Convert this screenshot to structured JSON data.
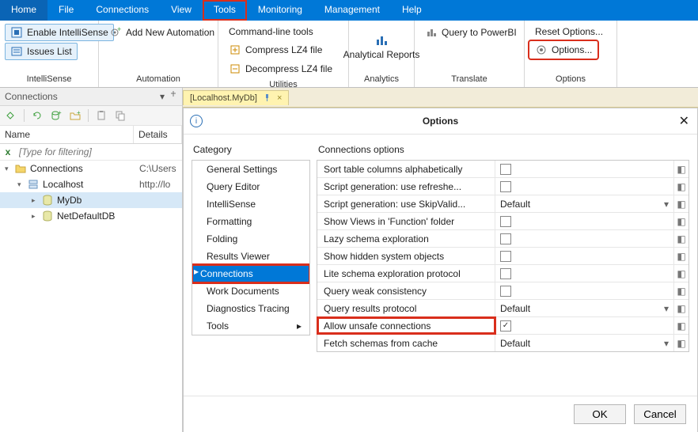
{
  "menu": [
    "Home",
    "File",
    "Connections",
    "View",
    "Tools",
    "Monitoring",
    "Management",
    "Help"
  ],
  "menu_hl_index": 4,
  "ribbon": {
    "intellisense": {
      "enable": "Enable IntelliSense",
      "issues": "Issues List",
      "label": "IntelliSense"
    },
    "automation": {
      "add": "Add New Automation",
      "label": "Automation"
    },
    "utilities": {
      "cmd": "Command-line tools",
      "compress": "Compress LZ4 file",
      "decompress": "Decompress LZ4 file",
      "label": "Utilities"
    },
    "analytics": {
      "reports": "Analytical\nReports",
      "label": "Analytics"
    },
    "translate": {
      "query": "Query to PowerBI",
      "label": "Translate"
    },
    "options": {
      "reset": "Reset Options...",
      "options": "Options...",
      "label": "Options"
    }
  },
  "left": {
    "title": "Connections",
    "col_name": "Name",
    "col_details": "Details",
    "filter_placeholder": "[Type for filtering]",
    "tree": [
      {
        "level": 0,
        "exp": "▾",
        "icon": "folder",
        "label": "Connections",
        "details": "C:\\Users"
      },
      {
        "level": 1,
        "exp": "▾",
        "icon": "server",
        "label": "Localhost",
        "details": "http://lo"
      },
      {
        "level": 2,
        "exp": "▸",
        "icon": "db",
        "label": "MyDb",
        "details": "",
        "sel": true
      },
      {
        "level": 2,
        "exp": "▸",
        "icon": "db",
        "label": "NetDefaultDB",
        "details": ""
      }
    ]
  },
  "doc_tab": "[Localhost.MyDb]",
  "dialog": {
    "title": "Options",
    "cat_title": "Category",
    "categories": [
      {
        "label": "General Settings",
        "sub": true
      },
      {
        "label": "Query Editor",
        "sub": true
      },
      {
        "label": "IntelliSense",
        "sub": true
      },
      {
        "label": "Formatting",
        "sub": true
      },
      {
        "label": "Folding",
        "sub": true
      },
      {
        "label": "Results Viewer",
        "sub": true
      },
      {
        "label": "Connections",
        "sub": false,
        "sel": true,
        "hl": true
      },
      {
        "label": "Work Documents",
        "sub": true
      },
      {
        "label": "Diagnostics Tracing",
        "sub": true
      },
      {
        "label": "Tools",
        "sub": true,
        "expand": true
      }
    ],
    "opt_title": "Connections options",
    "options": [
      {
        "name": "Sort table columns alphabetically",
        "value": "",
        "check": false
      },
      {
        "name": "Script generation: use refreshe...",
        "value": "",
        "check": false
      },
      {
        "name": "Script generation: use SkipValid...",
        "value": "Default",
        "check": null
      },
      {
        "name": "Show Views in 'Function' folder",
        "value": "",
        "check": false
      },
      {
        "name": "Lazy schema exploration",
        "value": "",
        "check": false
      },
      {
        "name": "Show hidden system objects",
        "value": "",
        "check": false
      },
      {
        "name": "Lite schema exploration protocol",
        "value": "",
        "check": false
      },
      {
        "name": "Query weak consistency",
        "value": "",
        "check": false
      },
      {
        "name": "Query results protocol",
        "value": "Default",
        "check": null
      },
      {
        "name": "Allow unsafe connections",
        "value": "",
        "check": true,
        "hl": true
      },
      {
        "name": "Fetch schemas from cache",
        "value": "Default",
        "check": null
      }
    ],
    "ok": "OK",
    "cancel": "Cancel"
  }
}
